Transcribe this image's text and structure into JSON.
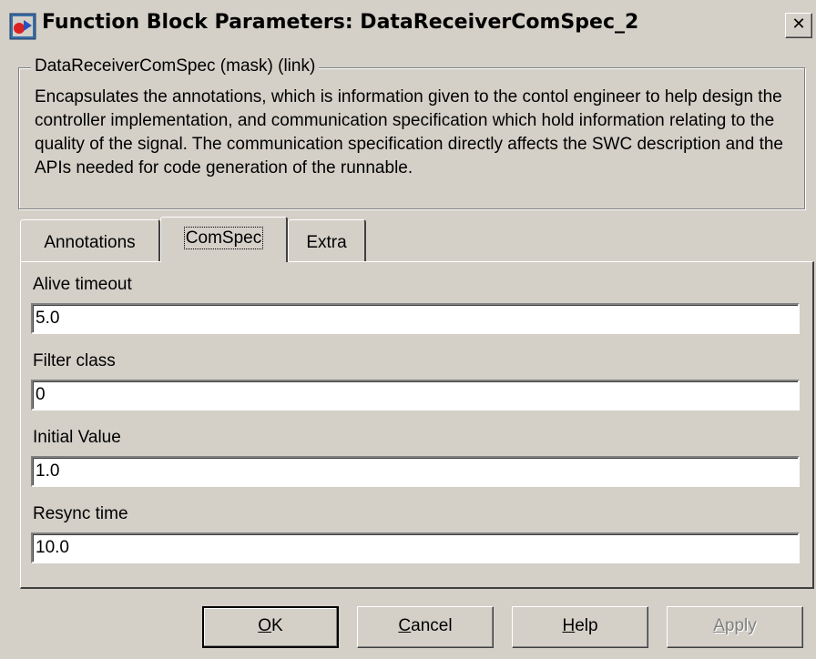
{
  "window": {
    "title": "Function Block Parameters: DataReceiverComSpec_2",
    "close_glyph": "✕"
  },
  "mask": {
    "legend": "DataReceiverComSpec (mask) (link)",
    "description": "Encapsulates the annotations, which is information given to the contol engineer to help design the controller implementation, and communication specification which hold information relating to the quality of the signal. The communication specification directly affects the SWC description and the APIs needed for code generation of the runnable."
  },
  "tabs": [
    {
      "label": "Annotations",
      "active": false
    },
    {
      "label": "ComSpec",
      "active": true
    },
    {
      "label": "Extra",
      "active": false
    }
  ],
  "fields": {
    "alive_timeout": {
      "label": "Alive timeout",
      "value": "5.0"
    },
    "filter_class": {
      "label": "Filter class",
      "value": "0"
    },
    "initial_value": {
      "label": "Initial Value",
      "value": "1.0"
    },
    "resync_time": {
      "label": "Resync time",
      "value": "10.0"
    }
  },
  "buttons": {
    "ok": {
      "mnemonic": "O",
      "rest": "K"
    },
    "cancel": {
      "mnemonic": "C",
      "rest": "ancel"
    },
    "help": {
      "mnemonic": "H",
      "rest": "elp"
    },
    "apply": {
      "mnemonic": "A",
      "rest": "pply",
      "disabled": true
    }
  }
}
